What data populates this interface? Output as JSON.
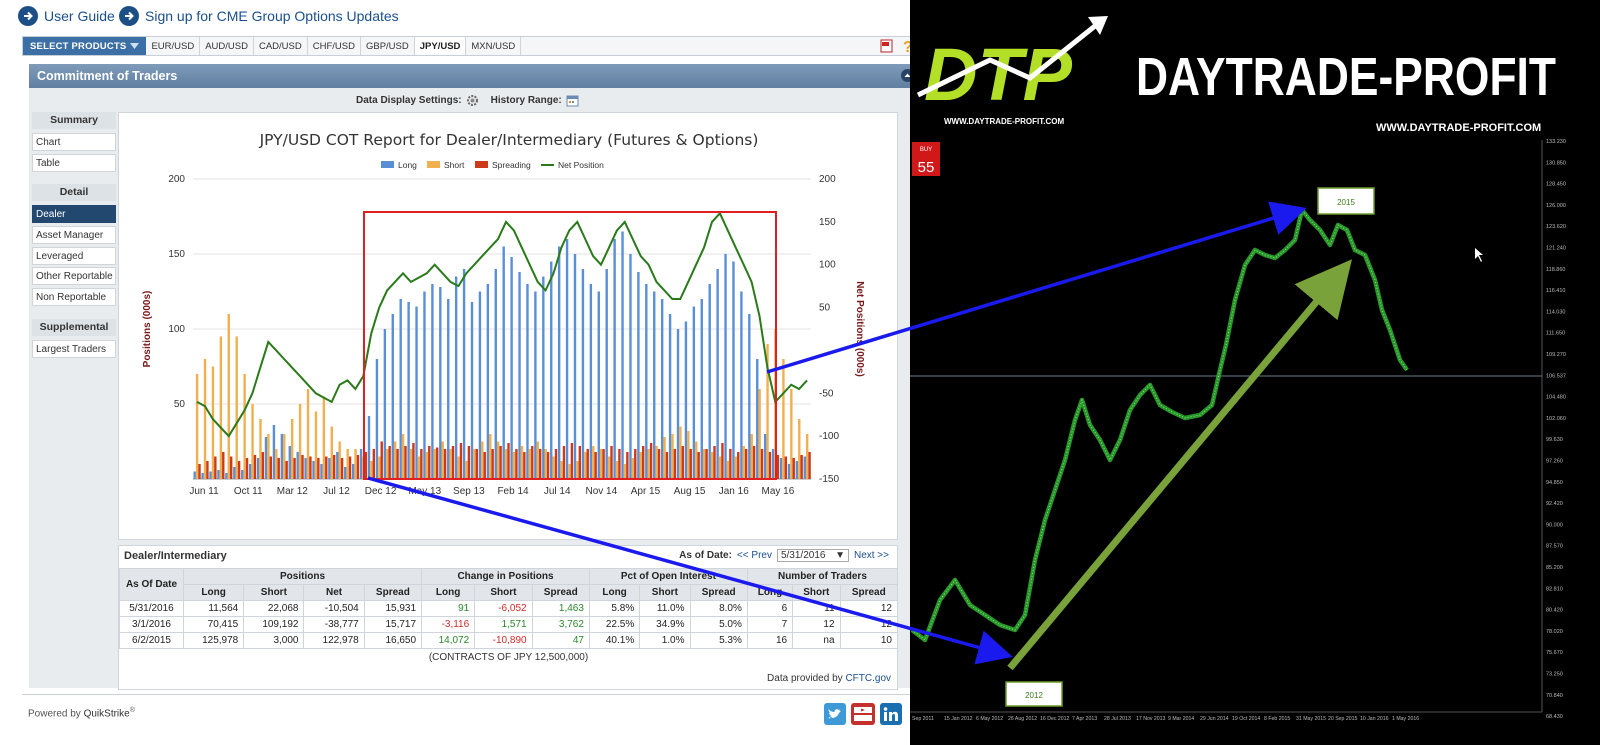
{
  "top_links": [
    "User Guide",
    "Sign up for CME Group Options Updates"
  ],
  "select_products": "SELECT PRODUCTS",
  "product_tabs": [
    {
      "label": "EUR/USD",
      "active": false
    },
    {
      "label": "AUD/USD",
      "active": false
    },
    {
      "label": "CAD/USD",
      "active": false
    },
    {
      "label": "CHF/USD",
      "active": false
    },
    {
      "label": "GBP/USD",
      "active": false
    },
    {
      "label": "JPY/USD",
      "active": true
    },
    {
      "label": "MXN/USD",
      "active": false
    }
  ],
  "section_title": "Commitment of Traders",
  "display_settings": "Data Display Settings:",
  "history_range": "History Range:",
  "sidebar": {
    "summary": "Summary",
    "summary_items": [
      "Chart",
      "Table"
    ],
    "detail": "Detail",
    "detail_items": [
      "Dealer",
      "Asset Manager",
      "Leveraged",
      "Other Reportable",
      "Non Reportable"
    ],
    "supplemental": "Supplemental",
    "supplemental_items": [
      "Largest Traders"
    ]
  },
  "chart_data": {
    "type": "bar",
    "title": "JPY/USD COT Report for Dealer/Intermediary (Futures & Options)",
    "ylabel": "Positions (000s)",
    "y2label": "Net Positions (000s)",
    "ylim": [
      0,
      200
    ],
    "y2lim": [
      -150,
      200
    ],
    "yticks": [
      50,
      100,
      150,
      200
    ],
    "y2ticks": [
      -150,
      -100,
      -50,
      50,
      100,
      150,
      200
    ],
    "xticks": [
      "Jun 11",
      "Oct 11",
      "Mar 12",
      "Jul 12",
      "Dec 12",
      "May 13",
      "Sep 13",
      "Feb 14",
      "Jul 14",
      "Nov 14",
      "Apr 15",
      "Aug 15",
      "Jan 16",
      "May 16"
    ],
    "legend": [
      "Long",
      "Short",
      "Spreading",
      "Net Position"
    ],
    "colors": {
      "long": "#5a8fd8",
      "short": "#f0b050",
      "spreading": "#cc3a1a",
      "net": "#2a7a1a"
    },
    "series": [
      {
        "name": "Long",
        "values": [
          5,
          4,
          5,
          6,
          4,
          8,
          6,
          10,
          14,
          28,
          36,
          30,
          22,
          18,
          14,
          12,
          10,
          14,
          18,
          8,
          10,
          20,
          42,
          80,
          100,
          110,
          120,
          118,
          115,
          125,
          130,
          128,
          120,
          135,
          140,
          118,
          125,
          130,
          140,
          155,
          148,
          138,
          130,
          125,
          135,
          145,
          155,
          160,
          150,
          140,
          130,
          125,
          140,
          160,
          165,
          150,
          138,
          130,
          125,
          120,
          110,
          100,
          105,
          115,
          120,
          130,
          140,
          150,
          145,
          125,
          110,
          80,
          30,
          20,
          14,
          10,
          12,
          15
        ]
      },
      {
        "name": "Short",
        "values": [
          70,
          80,
          75,
          95,
          110,
          95,
          70,
          50,
          40,
          30,
          20,
          30,
          40,
          50,
          60,
          45,
          55,
          35,
          25,
          20,
          20,
          15,
          12,
          15,
          20,
          25,
          30,
          20,
          15,
          18,
          20,
          25,
          20,
          15,
          12,
          20,
          25,
          30,
          25,
          20,
          18,
          22,
          20,
          25,
          20,
          15,
          12,
          10,
          12,
          18,
          22,
          20,
          15,
          12,
          10,
          14,
          18,
          20,
          22,
          28,
          30,
          35,
          32,
          25,
          20,
          18,
          15,
          12,
          15,
          22,
          30,
          60,
          90,
          100,
          80,
          60,
          40,
          30
        ]
      },
      {
        "name": "Spreading",
        "values": [
          10,
          12,
          15,
          18,
          15,
          12,
          14,
          16,
          18,
          15,
          14,
          12,
          14,
          16,
          15,
          14,
          15,
          16,
          14,
          15,
          16,
          18,
          20,
          25,
          22,
          20,
          22,
          24,
          20,
          22,
          21,
          20,
          22,
          24,
          22,
          20,
          18,
          20,
          22,
          24,
          20,
          18,
          22,
          20,
          18,
          20,
          22,
          24,
          22,
          20,
          18,
          20,
          22,
          20,
          18,
          20,
          22,
          24,
          20,
          18,
          20,
          22,
          20,
          18,
          20,
          22,
          24,
          20,
          18,
          20,
          22,
          20,
          18,
          16,
          15,
          14,
          16,
          18
        ]
      },
      {
        "name": "Net Position",
        "values": [
          -60,
          -65,
          -80,
          -90,
          -100,
          -85,
          -70,
          -50,
          -20,
          10,
          0,
          -10,
          -20,
          -30,
          -40,
          -50,
          -55,
          -60,
          -40,
          -35,
          -45,
          -30,
          20,
          50,
          70,
          80,
          90,
          80,
          85,
          90,
          100,
          90,
          80,
          75,
          90,
          100,
          110,
          120,
          130,
          150,
          140,
          120,
          100,
          80,
          70,
          90,
          120,
          140,
          150,
          130,
          110,
          100,
          120,
          140,
          150,
          130,
          110,
          100,
          80,
          70,
          60,
          60,
          80,
          100,
          120,
          150,
          160,
          140,
          120,
          100,
          80,
          40,
          -20,
          -60,
          -50,
          -40,
          -45,
          -35
        ]
      }
    ]
  },
  "table": {
    "title": "Dealer/Intermediary",
    "as_of_label": "As of Date:",
    "prev": "<< Prev",
    "date_value": "5/31/2016",
    "next": "Next >>",
    "header_groups": [
      "As Of Date",
      "Positions",
      "Change in Positions",
      "Pct of Open Interest",
      "Number of Traders"
    ],
    "subheaders": [
      "Long",
      "Short",
      "Net",
      "Spread",
      "Long",
      "Short",
      "Spread",
      "Long",
      "Short",
      "Spread",
      "Long",
      "Short",
      "Spread"
    ],
    "rows": [
      {
        "date": "5/31/2016",
        "cells": [
          "11,564",
          "22,068",
          "-10,504",
          "15,931",
          "91",
          "-6,052",
          "1,463",
          "5.8%",
          "11.0%",
          "8.0%",
          "6",
          "11",
          "12"
        ],
        "colors": [
          "",
          "",
          "",
          "",
          "pos",
          "neg",
          "pos",
          "",
          "",
          "",
          "",
          "",
          ""
        ]
      },
      {
        "date": "3/1/2016",
        "cells": [
          "70,415",
          "109,192",
          "-38,777",
          "15,717",
          "-3,116",
          "1,571",
          "3,762",
          "22.5%",
          "34.9%",
          "5.0%",
          "7",
          "12",
          "12"
        ],
        "colors": [
          "",
          "",
          "",
          "",
          "neg",
          "pos",
          "pos",
          "",
          "",
          "",
          "",
          "",
          ""
        ]
      },
      {
        "date": "6/2/2015",
        "cells": [
          "125,978",
          "3,000",
          "122,978",
          "16,650",
          "14,072",
          "-10,890",
          "47",
          "40.1%",
          "1.0%",
          "5.3%",
          "16",
          "na",
          "10"
        ],
        "colors": [
          "",
          "",
          "",
          "",
          "pos",
          "neg",
          "pos",
          "",
          "",
          "",
          "",
          "",
          ""
        ]
      }
    ],
    "footer": "(CONTRACTS OF JPY 12,500,000)",
    "data_provided": "Data provided by",
    "cftc": "CFTC.gov"
  },
  "powered_by": "Powered by",
  "quikstrike": "QuikStrike",
  "brand": {
    "logo": "DTP",
    "name": "DAYTRADE-PROFIT",
    "url": "WWW.DAYTRADE-PROFIT.COM"
  },
  "price_chart": {
    "buy_label": "BUY",
    "buy_value": "55",
    "label_2015": "2015",
    "label_2012": "2012",
    "price_ticks": [
      "133.230",
      "130.850",
      "128.450",
      "126.000",
      "123.620",
      "121.240",
      "118.860",
      "116.410",
      "114.030",
      "111.650",
      "109.270",
      "106.537",
      "104.480",
      "102.060",
      "99.630",
      "97.260",
      "94.850",
      "92.420",
      "90.000",
      "87.570",
      "85.200",
      "82.810",
      "80.420",
      "78.020",
      "75.670",
      "73.250",
      "70.840",
      "68.430"
    ],
    "date_ticks": [
      "Sep 2011",
      "15 Jan 2012",
      "6 May 2012",
      "26 Aug 2012",
      "16 Dec 2012",
      "7 Apr 2013",
      "28 Jul 2013",
      "17 Nov 2013",
      "9 Mar 2014",
      "29 Jun 2014",
      "19 Oct 2014",
      "8 Feb 2015",
      "31 May 2015",
      "20 Sep 2015",
      "10 Jan 2016",
      "1 May 2016"
    ]
  }
}
